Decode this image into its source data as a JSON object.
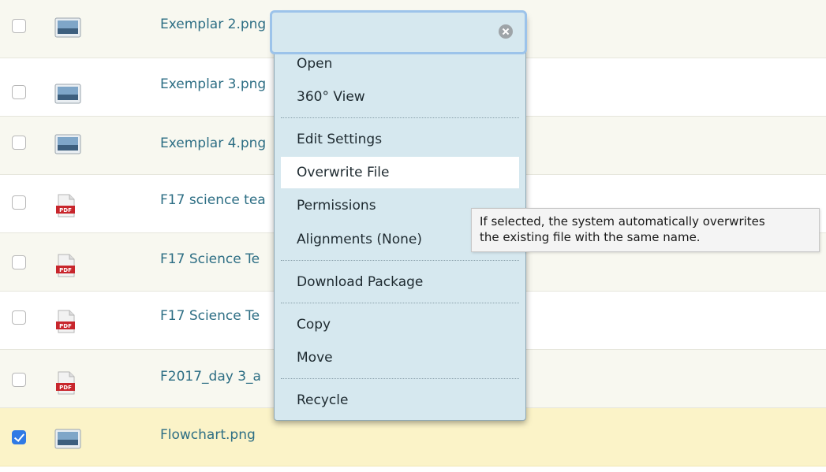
{
  "files": [
    {
      "name": "Exemplar 2.png",
      "type": "image",
      "checked": false
    },
    {
      "name": "Exemplar 3.png",
      "type": "image",
      "checked": false
    },
    {
      "name": "Exemplar 4.png",
      "type": "image",
      "checked": false
    },
    {
      "name": "F17 science tea",
      "type": "pdf",
      "checked": false
    },
    {
      "name": "F17 Science Te",
      "type": "pdf",
      "checked": false
    },
    {
      "name": "F17 Science Te",
      "type": "pdf",
      "checked": false
    },
    {
      "name": "F2017_day 3_a",
      "type": "pdf",
      "checked": false
    },
    {
      "name": "Flowchart.png",
      "type": "image",
      "checked": true
    }
  ],
  "pdf_icon_label": "PDF",
  "menu": {
    "search_value": "",
    "items": [
      {
        "label": "Open"
      },
      {
        "label": "360° View"
      },
      {
        "label": "Edit Settings"
      },
      {
        "label": "Overwrite File"
      },
      {
        "label": "Permissions"
      },
      {
        "label": "Alignments (None)"
      },
      {
        "label": "Download Package"
      },
      {
        "label": "Copy"
      },
      {
        "label": "Move"
      },
      {
        "label": "Recycle"
      }
    ]
  },
  "tooltip": {
    "line1": "If selected, the system automatically overwrites",
    "line2": "the existing file with the same name."
  },
  "colors": {
    "link": "#2d6e84",
    "selected_row": "#fbf3c8",
    "menu_bg": "#d6e8ef",
    "checkbox_checked": "#2f7ae5",
    "pdf_red": "#c8262c"
  }
}
